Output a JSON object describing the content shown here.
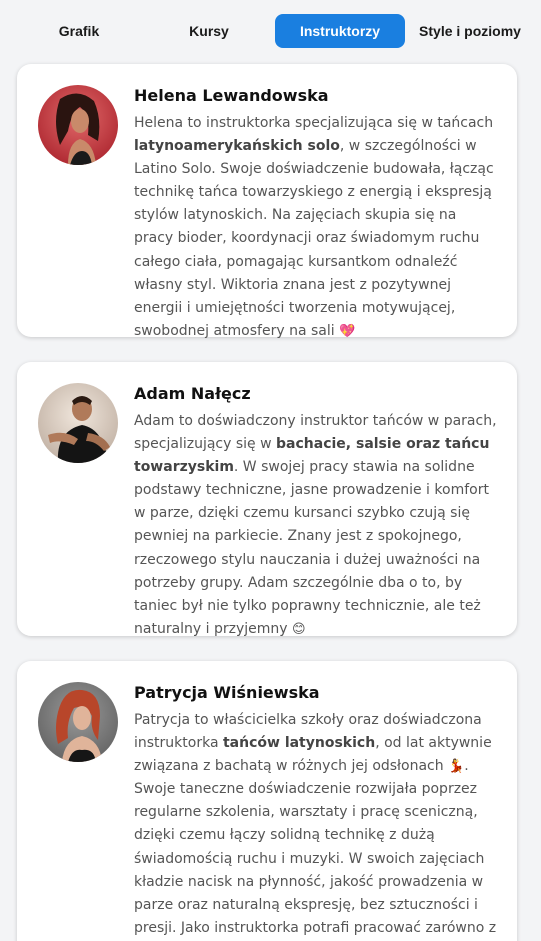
{
  "tabs": [
    {
      "label": "Grafik",
      "active": false
    },
    {
      "label": "Kursy",
      "active": false
    },
    {
      "label": "Instruktorzy",
      "active": true
    },
    {
      "label": "Style i poziomy",
      "active": false
    }
  ],
  "colors": {
    "accent": "#1a7fe0",
    "background": "#f3f4f6",
    "card": "#ffffff"
  },
  "instructors": [
    {
      "name": "Helena Lewandowska",
      "bio": [
        {
          "text": "Helena to instruktorka specjalizująca się w tańcach "
        },
        {
          "text": "latynoamerykańskich solo",
          "bold": true
        },
        {
          "text": ", w szczególności w Latino Solo. Swoje doświadczenie budowała, łącząc technikę tańca towarzyskiego z energią i ekspresją stylów latynoskich. Na zajęciach skupia się na pracy bioder, koordynacji oraz świadomym ruchu całego ciała, pomagając kursantkom odnaleźć własny styl. Wiktoria znana jest z pozytywnej energii i umiejętności tworzenia motywującej, swobodnej atmosfery na sali "
        },
        {
          "text": "💖",
          "emoji": true
        }
      ]
    },
    {
      "name": "Adam Nałęcz",
      "bio": [
        {
          "text": "Adam to doświadczony instruktor tańców w parach, specjalizujący się w "
        },
        {
          "text": "bachacie, salsie oraz tańcu towarzyskim",
          "bold": true
        },
        {
          "text": ". W swojej pracy stawia na solidne podstawy techniczne, jasne prowadzenie i komfort w parze, dzięki czemu kursanci szybko czują się pewniej na parkiecie. Znany jest z spokojnego, rzeczowego stylu nauczania i dużej uważności na potrzeby grupy. Adam szczególnie dba o to, by taniec był nie tylko poprawny technicznie, ale też naturalny i przyjemny "
        },
        {
          "text": "😊",
          "emoji": true
        }
      ]
    },
    {
      "name": "Patrycja Wiśniewska",
      "bio": [
        {
          "text": "Patrycja to właścicielka szkoły oraz doświadczona instruktorka "
        },
        {
          "text": "tańców latynoskich",
          "bold": true
        },
        {
          "text": ", od lat aktywnie związana z bachatą w różnych jej odsłonach "
        },
        {
          "text": "💃",
          "emoji": true
        },
        {
          "text": ". Swoje taneczne doświadczenie rozwijała poprzez regularne szkolenia, warsztaty i pracę sceniczną, dzięki czemu łączy solidną technikę z dużą świadomością ruchu i muzyki. W swoich zajęciach kładzie nacisk na płynność, jakość prowadzenia w parze oraz naturalną ekspresję, bez sztuczności i presji. Jako instruktorka potrafi pracować zarówno z osobami początkującymi, jak i bardziej"
        }
      ]
    }
  ]
}
